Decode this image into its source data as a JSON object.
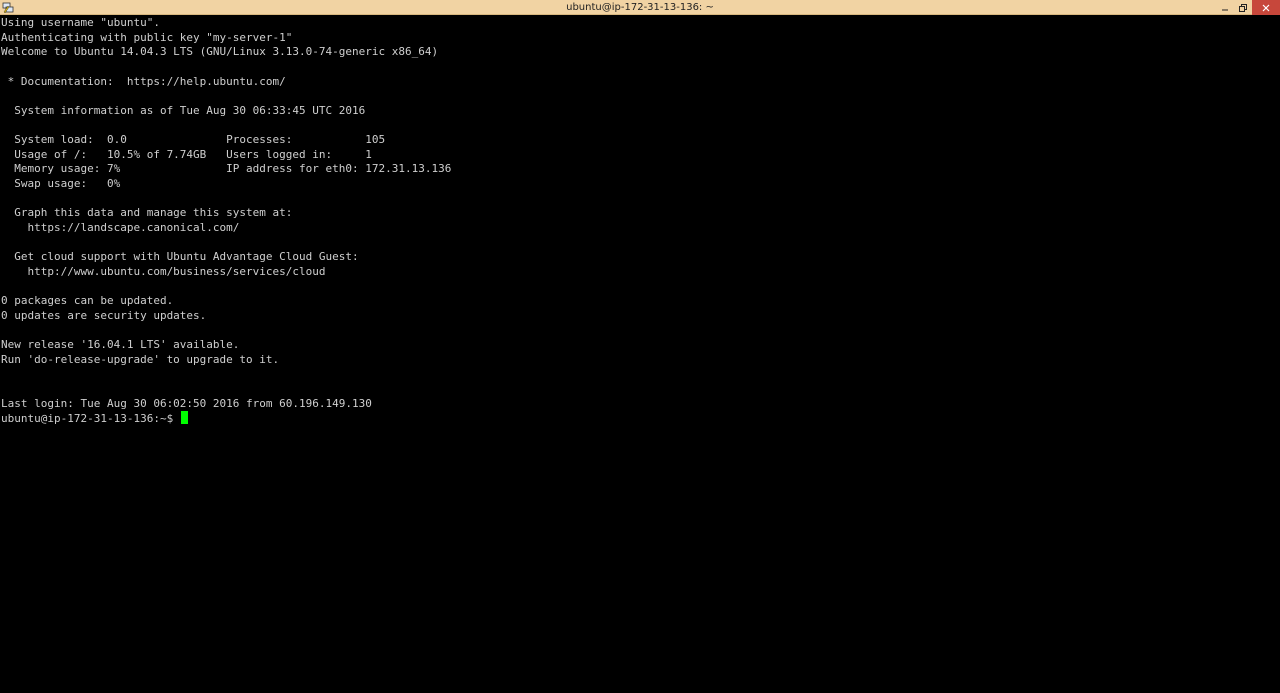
{
  "window": {
    "title": "ubuntu@ip-172-31-13-136: ~",
    "app_icon": "putty-icon",
    "controls": [
      "minimize-icon",
      "restore-icon",
      "close-icon"
    ]
  },
  "terminal": {
    "lines": [
      "Using username \"ubuntu\".",
      "Authenticating with public key \"my-server-1\"",
      "Welcome to Ubuntu 14.04.3 LTS (GNU/Linux 3.13.0-74-generic x86_64)",
      "",
      " * Documentation:  https://help.ubuntu.com/",
      "",
      "  System information as of Tue Aug 30 06:33:45 UTC 2016",
      "",
      "  System load:  0.0               Processes:           105",
      "  Usage of /:   10.5% of 7.74GB   Users logged in:     1",
      "  Memory usage: 7%                IP address for eth0: 172.31.13.136",
      "  Swap usage:   0%",
      "",
      "  Graph this data and manage this system at:",
      "    https://landscape.canonical.com/",
      "",
      "  Get cloud support with Ubuntu Advantage Cloud Guest:",
      "    http://www.ubuntu.com/business/services/cloud",
      "",
      "0 packages can be updated.",
      "0 updates are security updates.",
      "",
      "New release '16.04.1 LTS' available.",
      "Run 'do-release-upgrade' to upgrade to it.",
      "",
      "",
      "Last login: Tue Aug 30 06:02:50 2016 from 60.196.149.130"
    ],
    "prompt": "ubuntu@ip-172-31-13-136:~$ ",
    "cursor_color": "#00ff00",
    "text_color": "#cfcfcf",
    "background_color": "#000000"
  },
  "colors": {
    "titlebar": "#f1d3a3",
    "close_button": "#c7473b"
  }
}
